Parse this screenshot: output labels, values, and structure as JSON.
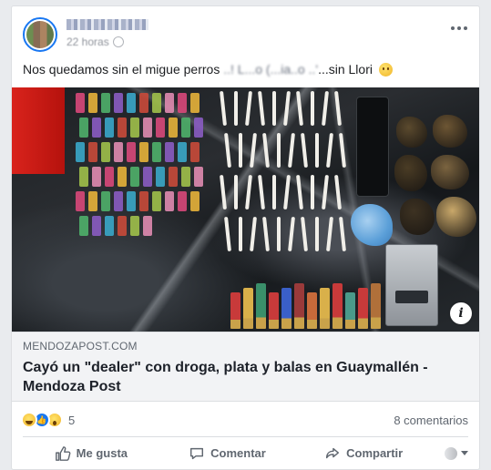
{
  "post": {
    "timestamp": "22 horas",
    "text_before": "Nos quedamos sin el migue perros ",
    "text_hidden": "..! L...o (...ia..o ..'",
    "text_after": "...sin Llori"
  },
  "link": {
    "domain": "MENDOZAPOST.COM",
    "title": "Cayó un \"dealer\" con droga, plata y balas en Guaymallén - Mendoza Post"
  },
  "stats": {
    "reaction_count": "5",
    "comments": "8 comentarios"
  },
  "actions": {
    "like": "Me gusta",
    "comment": "Comentar",
    "share": "Compartir"
  },
  "icons": {
    "more": "more-dots-icon",
    "info": "info-icon",
    "globe": "globe-icon",
    "reactions": [
      "haha-icon",
      "like-icon",
      "wow-icon"
    ]
  },
  "colors": {
    "accent": "#1877f2",
    "text_secondary": "#606770",
    "link_bg": "#f2f3f5"
  }
}
